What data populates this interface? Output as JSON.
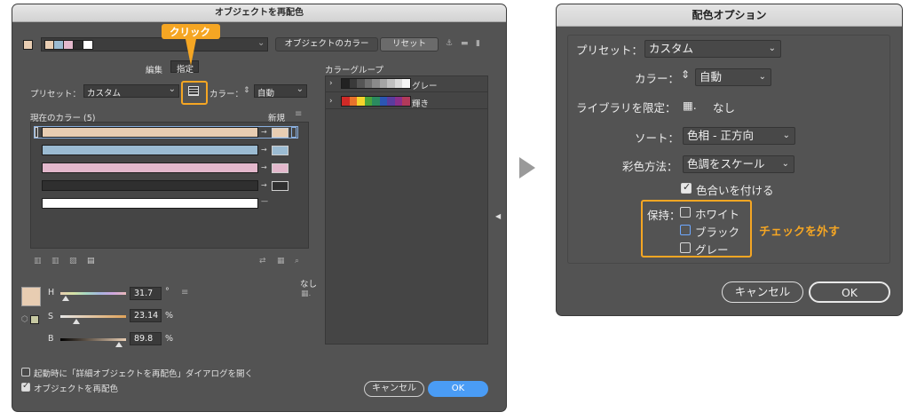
{
  "left_dialog": {
    "title": "オブジェクトを再配色",
    "objects_color_button": "オブジェクトのカラー",
    "reset_button": "リセット",
    "tabs": {
      "edit": "編集",
      "assign": "指定"
    },
    "callout_label": "クリック",
    "preset_label": "プリセット：",
    "preset_value": "カスタム",
    "color_label": "カラー：",
    "color_value": "自動",
    "current_colors_label": "現在のカラー (5)",
    "new_label": "新規",
    "current_colors": [
      "#e8cdb2",
      "#9bbbd2",
      "#e3b8cc",
      "#2f2f2f",
      "#ffffff"
    ],
    "top_swatches": [
      "#e8cdb2",
      "#9bbbd2",
      "#e3b8cc",
      "#2f2f2f",
      "#ffffff"
    ],
    "color_group_label": "カラーグループ",
    "groups": [
      {
        "name": "グレー",
        "colors": [
          "#222222",
          "#3a3a3a",
          "#555555",
          "#707070",
          "#8a8a8a",
          "#a5a5a5",
          "#c0c0c0",
          "#dadada",
          "#f5f5f5"
        ]
      },
      {
        "name": "輝き",
        "colors": [
          "#cf2a27",
          "#e8722b",
          "#f5d32b",
          "#4aa33b",
          "#2a8a5f",
          "#2b56b3",
          "#5a3c9e",
          "#8a2f8a",
          "#b23a5a"
        ]
      }
    ],
    "hsb": {
      "h_label": "H",
      "h_value": "31.7",
      "h_unit": "°",
      "s_label": "S",
      "s_value": "23.14",
      "s_unit": "%",
      "b_label": "B",
      "b_value": "89.8",
      "b_unit": "%"
    },
    "none_label": "なし",
    "main_swatch": "#e8cdb2",
    "checkbox_open_on_start": "起動時に「詳細オブジェクトを再配色」ダイアログを開く",
    "checkbox_recolor": "オブジェクトを再配色",
    "cancel_button": "キャンセル",
    "ok_button": "OK"
  },
  "right_dialog": {
    "title": "配色オプション",
    "preset_label": "プリセット：",
    "preset_value": "カスタム",
    "color_label": "カラー：",
    "color_value": "自動",
    "library_label": "ライブラリを限定：",
    "library_value": "なし",
    "sort_label": "ソート：",
    "sort_value": "色相 - 正方向",
    "coloring_label": "彩色方法：",
    "coloring_value": "色調をスケール",
    "tint_label": "色合いを付ける",
    "keep_label": "保持：",
    "keep_white": "ホワイト",
    "keep_black": "ブラック",
    "keep_grey": "グレー",
    "annotation": "チェックを外す",
    "cancel_button": "キャンセル",
    "ok_button": "OK"
  },
  "colors": {
    "accent": "#f5a623",
    "ok_blue": "#4a9cf5"
  }
}
